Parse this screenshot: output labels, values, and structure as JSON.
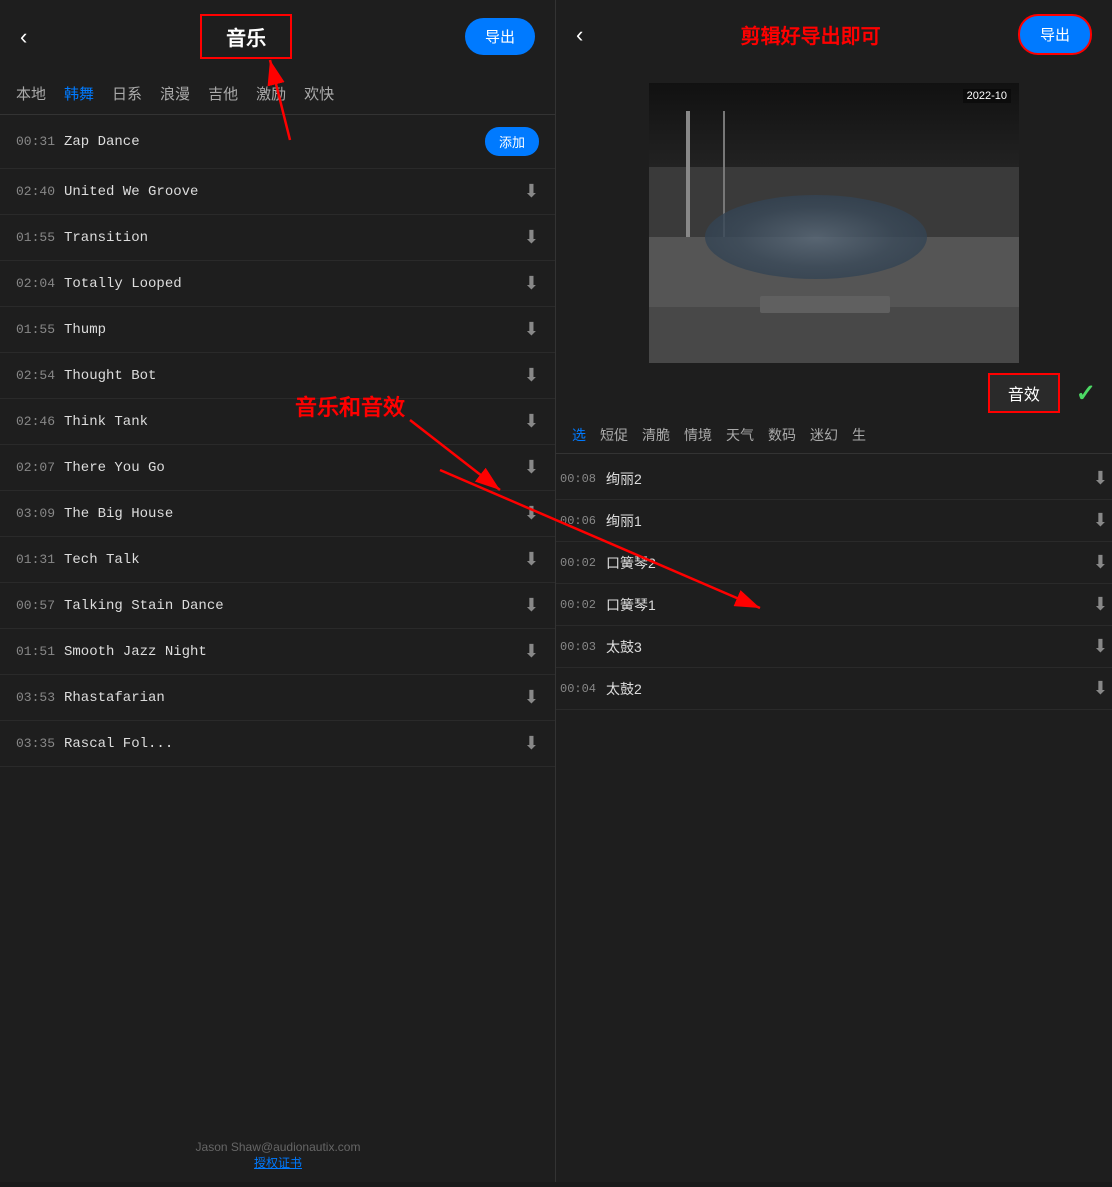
{
  "left": {
    "back_label": "‹",
    "title": "音乐",
    "export_label": "导出",
    "tabs": [
      {
        "label": "本地",
        "active": false
      },
      {
        "label": "韩舞",
        "active": true
      },
      {
        "label": "日系",
        "active": false
      },
      {
        "label": "浪漫",
        "active": false
      },
      {
        "label": "吉他",
        "active": false
      },
      {
        "label": "激励",
        "active": false
      },
      {
        "label": "欢快",
        "active": false
      }
    ],
    "tracks": [
      {
        "time": "00:31",
        "name": "Zap Dance",
        "action": "add",
        "add_label": "添加"
      },
      {
        "time": "02:40",
        "name": "United We Groove",
        "action": "download"
      },
      {
        "time": "01:55",
        "name": "Transition",
        "action": "download"
      },
      {
        "time": "02:04",
        "name": "Totally Looped",
        "action": "download"
      },
      {
        "time": "01:55",
        "name": "Thump",
        "action": "download"
      },
      {
        "time": "02:54",
        "name": "Thought Bot",
        "action": "download"
      },
      {
        "time": "02:46",
        "name": "Think Tank",
        "action": "download"
      },
      {
        "time": "02:07",
        "name": "There You Go",
        "action": "download"
      },
      {
        "time": "03:09",
        "name": "The Big House",
        "action": "download"
      },
      {
        "time": "01:31",
        "name": "Tech Talk",
        "action": "download"
      },
      {
        "time": "00:57",
        "name": "Talking Stain Dance",
        "action": "download"
      },
      {
        "time": "01:51",
        "name": "Smooth Jazz Night",
        "action": "download"
      },
      {
        "time": "03:53",
        "name": "Rhastafarian",
        "action": "download"
      },
      {
        "time": "03:35",
        "name": "Rascal Fol...",
        "action": "download"
      }
    ],
    "footer_email": "Jason Shaw@audionautix.com",
    "footer_link": "授权证书"
  },
  "right": {
    "back_label": "‹",
    "export_label": "导出",
    "annotation_title": "剪辑好导出即可",
    "video_timestamp": "2022-10",
    "sfx_section": {
      "tabs": [
        {
          "label": "选",
          "active": true
        },
        {
          "label": "短促",
          "active": false
        },
        {
          "label": "清脆",
          "active": false
        },
        {
          "label": "情境",
          "active": false
        },
        {
          "label": "天气",
          "active": false
        },
        {
          "label": "数码",
          "active": false
        },
        {
          "label": "迷幻",
          "active": false
        },
        {
          "label": "生",
          "active": false
        }
      ],
      "items": [
        {
          "time": "00:08",
          "name": "绚丽2"
        },
        {
          "time": "00:06",
          "name": "绚丽1"
        },
        {
          "time": "00:02",
          "name": "口簧琴2"
        },
        {
          "time": "00:02",
          "name": "口簧琴1"
        },
        {
          "time": "00:03",
          "name": "太鼓3"
        },
        {
          "time": "00:04",
          "name": "太鼓2"
        }
      ]
    },
    "sfx_label": "音效",
    "checkmark": "✓",
    "annotation_music_sfx": "音乐和音效"
  }
}
